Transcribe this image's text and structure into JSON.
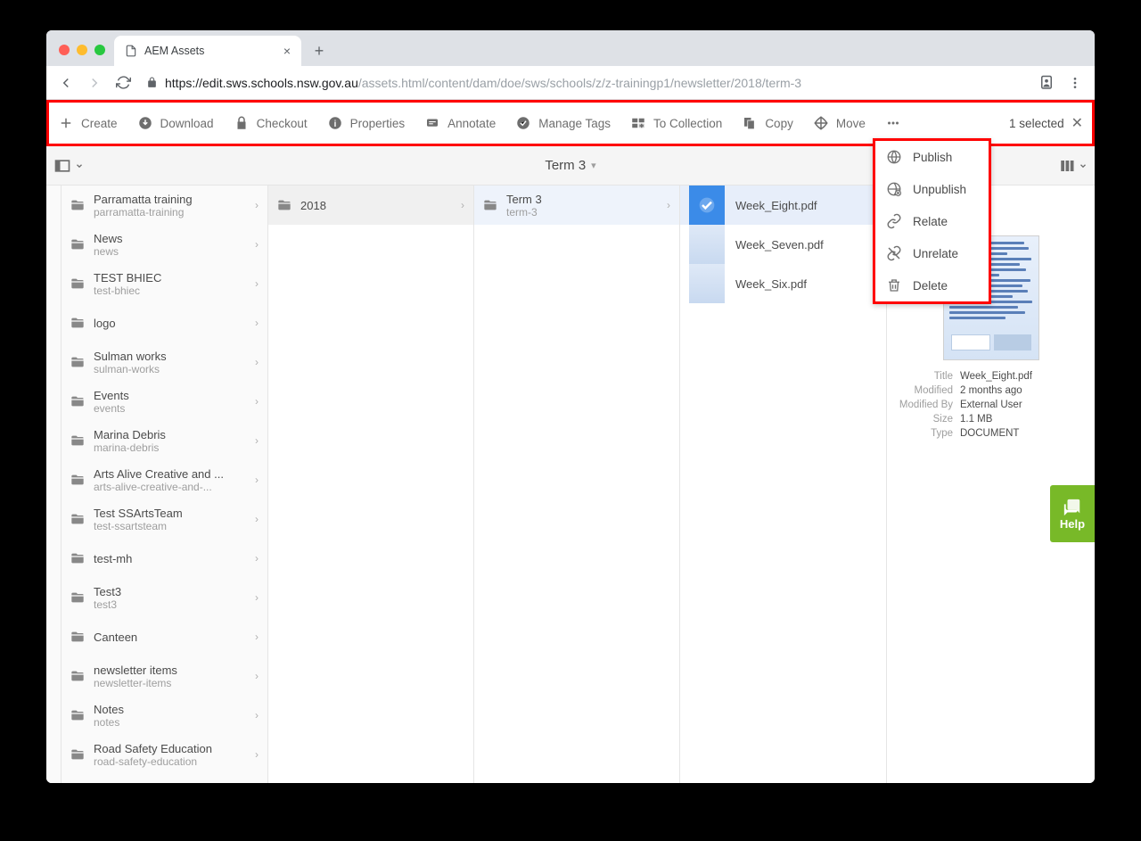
{
  "tab_title": "AEM Assets",
  "url_host": "https://edit.sws.schools.nsw.gov.au",
  "url_path": "/assets.html/content/dam/doe/sws/schools/z/z-trainingp1/newsletter/2018/term-3",
  "actions": {
    "create": "Create",
    "download": "Download",
    "checkout": "Checkout",
    "properties": "Properties",
    "annotate": "Annotate",
    "manage_tags": "Manage Tags",
    "to_collection": "To Collection",
    "copy": "Copy",
    "move": "Move"
  },
  "selection_text": "1 selected",
  "breadcrumb_current": "Term 3",
  "dropdown": {
    "publish": "Publish",
    "unpublish": "Unpublish",
    "relate": "Relate",
    "unrelate": "Unrelate",
    "delete": "Delete"
  },
  "col1": [
    {
      "name": "Parramatta training",
      "slug": "parramatta-training"
    },
    {
      "name": "News",
      "slug": "news"
    },
    {
      "name": "TEST BHIEC",
      "slug": "test-bhiec"
    },
    {
      "name": "logo",
      "slug": ""
    },
    {
      "name": "Sulman works",
      "slug": "sulman-works"
    },
    {
      "name": "Events",
      "slug": "events"
    },
    {
      "name": "Marina Debris",
      "slug": "marina-debris"
    },
    {
      "name": "Arts Alive Creative and ...",
      "slug": "arts-alive-creative-and-..."
    },
    {
      "name": "Test SSArtsTeam",
      "slug": "test-ssartsteam"
    },
    {
      "name": "test-mh",
      "slug": ""
    },
    {
      "name": "Test3",
      "slug": "test3"
    },
    {
      "name": "Canteen",
      "slug": ""
    },
    {
      "name": "newsletter items",
      "slug": "newsletter-items"
    },
    {
      "name": "Notes",
      "slug": "notes"
    },
    {
      "name": "Road Safety Education",
      "slug": "road-safety-education"
    }
  ],
  "col2": [
    {
      "name": "2018",
      "slug": ""
    }
  ],
  "col3": [
    {
      "name": "Term 3",
      "slug": "term-3"
    }
  ],
  "col4": [
    {
      "name": "Week_Eight.pdf",
      "selected": true
    },
    {
      "name": "Week_Seven.pdf",
      "selected": false
    },
    {
      "name": "Week_Six.pdf",
      "selected": false
    }
  ],
  "detail": {
    "labels": {
      "title": "Title",
      "modified": "Modified",
      "modified_by": "Modified By",
      "size": "Size",
      "type": "Type"
    },
    "title": "Week_Eight.pdf",
    "modified": "2 months ago",
    "modified_by": "External User",
    "size": "1.1 MB",
    "type": "DOCUMENT"
  },
  "help_label": "Help"
}
